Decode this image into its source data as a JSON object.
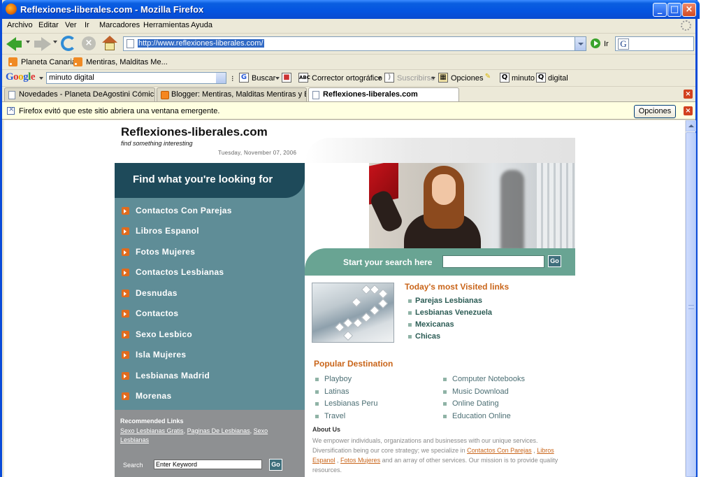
{
  "window": {
    "title": "Reflexiones-liberales.com - Mozilla Firefox"
  },
  "menu": [
    "Archivo",
    "Editar",
    "Ver",
    "Ir",
    "Marcadores",
    "Herramientas",
    "Ayuda"
  ],
  "navbar": {
    "url": "http://www.reflexiones-liberales.com/",
    "go_label": "Ir",
    "search_value": ""
  },
  "bookmarks": [
    "Planeta Canarias",
    "Mentiras, Malditas Me..."
  ],
  "google_toolbar": {
    "logo": "Google",
    "query": "minuto digital",
    "buscar": "Buscar",
    "corrector": "Corrector ortográfico",
    "suscribirse": "Suscribirse",
    "opciones": "Opciones",
    "term1": "minuto",
    "term2": "digital"
  },
  "tabs": [
    {
      "label": "Novedades - Planeta DeAgostini Cómics",
      "active": false
    },
    {
      "label": "Blogger: Mentiras, Malditas Mentiras y Esta...",
      "active": false
    },
    {
      "label": "Reflexiones-liberales.com",
      "active": true
    }
  ],
  "popup": {
    "text": "Firefox evitó que este sitio abriera una ventana emergente.",
    "button": "Opciones"
  },
  "site": {
    "title": "Reflexiones-liberales.com",
    "tagline": "find something interesting",
    "date": "Tuesday, November 07, 2006",
    "find_heading": "Find what you're looking for",
    "nav_links": [
      "Contactos Con Parejas",
      "Libros Espanol",
      "Fotos Mujeres",
      "Contactos Lesbianas",
      "Desnudas",
      "Contactos",
      "Sexo Lesbico",
      "Isla Mujeres",
      "Lesbianas Madrid",
      "Morenas"
    ],
    "recommended": {
      "title": "Recommended Links",
      "links": [
        "Sexo Lesbianas Gratis",
        "Paginas De Lesbianas",
        "Sexo Lesbianas"
      ],
      "search_label": "Search",
      "search_value": "Enter Keyword",
      "go": "Go"
    },
    "search_band": {
      "label": "Start your search here",
      "go": "Go"
    },
    "visited": {
      "title": "Today's most Visited links",
      "links": [
        "Parejas Lesbianas",
        "Lesbianas Venezuela",
        "Mexicanas",
        "Chicas"
      ]
    },
    "popular": {
      "title": "Popular Destination",
      "left": [
        "Playboy",
        "Latinas",
        "Lesbianas Peru",
        "Travel"
      ],
      "right": [
        "Computer Notebooks",
        "Music Download",
        "Online Dating",
        "Education Online"
      ]
    },
    "about": {
      "title": "About Us",
      "t1": "We empower individuals, organizations and businesses with our unique services. Diversification being our core strategy; we specialize in ",
      "l1": "Contactos Con Parejas",
      "t2": " , ",
      "l2": "Libros Espanol",
      "t3": " , ",
      "l3": "Fotos Mujeres",
      "t4": " and an array of other services. Our mission is to provide quality resources."
    }
  },
  "colors": {
    "nav_panel": "#5f8d97",
    "nav_header": "#1e4a5a",
    "search_band": "#69a493",
    "accent_orange": "#c9651a",
    "link_green": "#2c5c55"
  }
}
